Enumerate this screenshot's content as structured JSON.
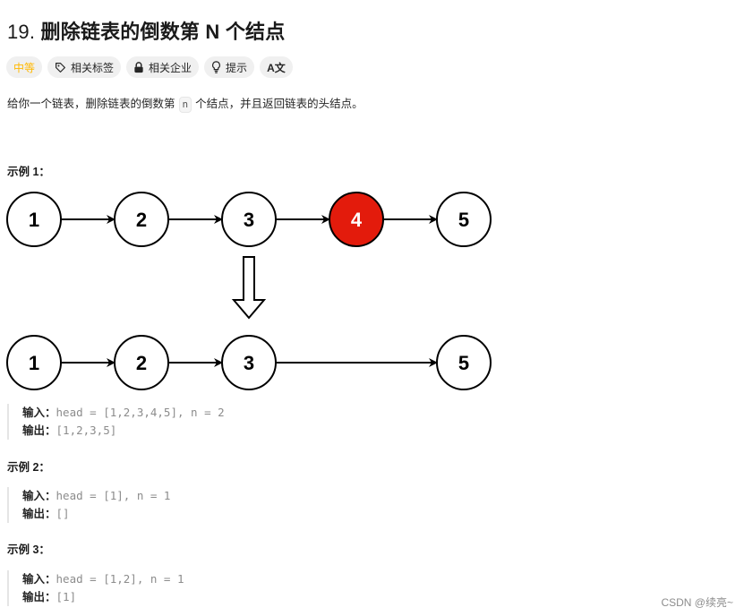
{
  "problem": {
    "number": "19.",
    "title": "删除链表的倒数第 N 个结点"
  },
  "tags": {
    "difficulty": "中等",
    "related_tags": "相关标签",
    "related_companies": "相关企业",
    "hint": "提示",
    "translate_icon_label": "A文"
  },
  "colors": {
    "difficulty": "#ffb800",
    "highlight_node": "#e31b0c"
  },
  "description": {
    "before": "给你一个链表，删除链表的倒数第",
    "code": "n",
    "after": "个结点，并且返回链表的头结点。"
  },
  "diagram": {
    "before_list": [
      "1",
      "2",
      "3",
      "4",
      "5"
    ],
    "removed_index": 3,
    "after_list": [
      "1",
      "2",
      "3",
      "5"
    ]
  },
  "examples": [
    {
      "title": "示例 1：",
      "input_label": "输入：",
      "input": "head = [1,2,3,4,5], n = 2",
      "output_label": "输出：",
      "output": "[1,2,3,5]"
    },
    {
      "title": "示例 2：",
      "input_label": "输入：",
      "input": "head = [1], n = 1",
      "output_label": "输出：",
      "output": "[]"
    },
    {
      "title": "示例 3：",
      "input_label": "输入：",
      "input": "head = [1,2], n = 1",
      "output_label": "输出：",
      "output": "[1]"
    }
  ],
  "watermark": "CSDN @续亮~"
}
